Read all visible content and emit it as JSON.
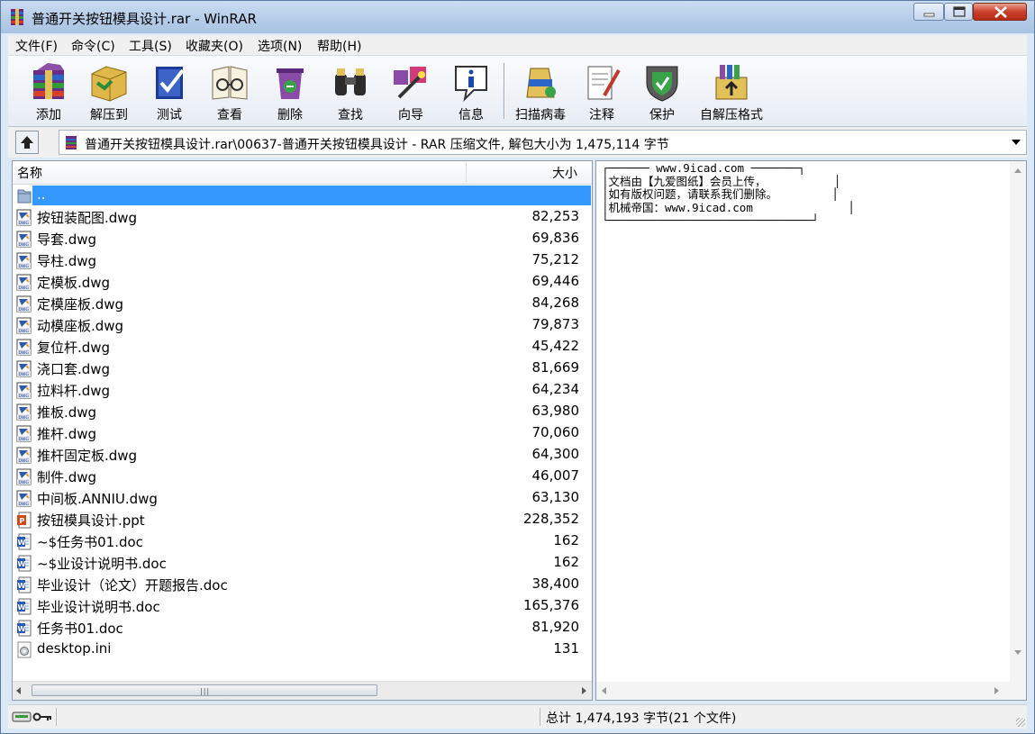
{
  "window": {
    "title": "普通开关按钮模具设计.rar - WinRAR",
    "controls": {
      "minimize_icon": "minimize-icon",
      "maximize_icon": "maximize-icon",
      "close_icon": "close-icon"
    }
  },
  "menu": [
    "文件(F)",
    "命令(C)",
    "工具(S)",
    "收藏夹(O)",
    "选项(N)",
    "帮助(H)"
  ],
  "toolbar": [
    {
      "label": "添加",
      "icon": "add-archive-icon"
    },
    {
      "label": "解压到",
      "icon": "extract-to-icon"
    },
    {
      "label": "测试",
      "icon": "test-icon"
    },
    {
      "label": "查看",
      "icon": "view-icon"
    },
    {
      "label": "删除",
      "icon": "delete-icon"
    },
    {
      "label": "查找",
      "icon": "find-icon"
    },
    {
      "label": "向导",
      "icon": "wizard-icon"
    },
    {
      "label": "信息",
      "icon": "info-icon"
    },
    {
      "label": "扫描病毒",
      "icon": "virus-scan-icon"
    },
    {
      "label": "注释",
      "icon": "comment-icon"
    },
    {
      "label": "保护",
      "icon": "protect-icon"
    },
    {
      "label": "自解压格式",
      "icon": "sfx-icon"
    }
  ],
  "address": {
    "path": "普通开关按钮模具设计.rar\\00637-普通开关按钮模具设计 - RAR 压缩文件, 解包大小为 1,475,114 字节"
  },
  "columns": {
    "name": "名称",
    "size": "大小"
  },
  "files": [
    {
      "name": "..",
      "size": "",
      "type": "folder-up",
      "selected": true
    },
    {
      "name": "按钮装配图.dwg",
      "size": "82,253",
      "type": "dwg"
    },
    {
      "name": "导套.dwg",
      "size": "69,836",
      "type": "dwg"
    },
    {
      "name": "导柱.dwg",
      "size": "75,212",
      "type": "dwg"
    },
    {
      "name": "定模板.dwg",
      "size": "69,446",
      "type": "dwg"
    },
    {
      "name": "定模座板.dwg",
      "size": "84,268",
      "type": "dwg"
    },
    {
      "name": "动模座板.dwg",
      "size": "79,873",
      "type": "dwg"
    },
    {
      "name": "复位杆.dwg",
      "size": "45,422",
      "type": "dwg"
    },
    {
      "name": "浇口套.dwg",
      "size": "81,669",
      "type": "dwg"
    },
    {
      "name": "拉料杆.dwg",
      "size": "64,234",
      "type": "dwg"
    },
    {
      "name": "推板.dwg",
      "size": "63,980",
      "type": "dwg"
    },
    {
      "name": "推杆.dwg",
      "size": "70,060",
      "type": "dwg"
    },
    {
      "name": "推杆固定板.dwg",
      "size": "64,300",
      "type": "dwg"
    },
    {
      "name": "制件.dwg",
      "size": "46,007",
      "type": "dwg"
    },
    {
      "name": "中间板.ANNIU.dwg",
      "size": "63,130",
      "type": "dwg"
    },
    {
      "name": "按钮模具设计.ppt",
      "size": "228,352",
      "type": "ppt"
    },
    {
      "name": "~$任务书01.doc",
      "size": "162",
      "type": "doc"
    },
    {
      "name": "~$业设计说明书.doc",
      "size": "162",
      "type": "doc"
    },
    {
      "name": "毕业设计（论文）开题报告.doc",
      "size": "38,400",
      "type": "doc"
    },
    {
      "name": "毕业设计说明书.doc",
      "size": "165,376",
      "type": "doc"
    },
    {
      "name": "任务书01.doc",
      "size": "81,920",
      "type": "doc"
    },
    {
      "name": "desktop.ini",
      "size": "131",
      "type": "ini"
    }
  ],
  "comment": "┌────── www.9icad.com ───────┐\n│文档由【九爱图纸】会员上传，          │\n│如有版权问题，请联系我们删除。        │\n│机械帝国：www.9icad.com              │\n└──────────────────────────────┘",
  "status": {
    "summary": "总计 1,474,193 字节(21 个文件)"
  },
  "colors": {
    "selection": "#3399ff",
    "title_bar": "#b9cfea",
    "close_button": "#c9402a"
  }
}
